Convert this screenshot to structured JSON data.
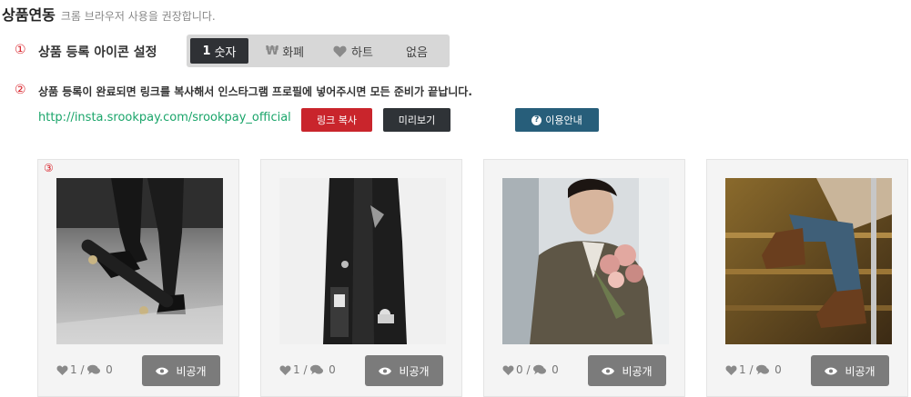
{
  "header": {
    "title": "상품연동",
    "subtitle": "크롬 브라우저 사용을 권장합니다."
  },
  "step1": {
    "number": "①",
    "label": "상품 등록 아이콘 설정",
    "options": [
      {
        "icon": "1",
        "label": "숫자",
        "active": true
      },
      {
        "icon": "₩",
        "label": "화폐",
        "active": false
      },
      {
        "icon": "heart-icon",
        "label": "하트",
        "active": false
      },
      {
        "icon": "",
        "label": "없음",
        "active": false
      }
    ]
  },
  "step2": {
    "number": "②",
    "label": "상품 등록이 완료되면 링크를 복사해서 인스타그램 프로필에 넣어주시면 모든 준비가 끝납니다.",
    "link": "http://insta.srookpay.com/srookpay_official",
    "copy_button": "링크 복사",
    "preview_button": "미리보기",
    "guide_button": "이용안내",
    "guide_icon": "?"
  },
  "step3": {
    "number": "③"
  },
  "cards": [
    {
      "likes": "1",
      "comments": "0",
      "visibility": "비공개"
    },
    {
      "likes": "1",
      "comments": "0",
      "visibility": "비공개"
    },
    {
      "likes": "0",
      "comments": "0",
      "visibility": "비공개"
    },
    {
      "likes": "1",
      "comments": "0",
      "visibility": "비공개"
    }
  ],
  "separator": "/",
  "colors": {
    "accent_red": "#c9252c",
    "link_green": "#1aa56a",
    "dark": "#2f3337",
    "guide_blue": "#275e7a"
  }
}
